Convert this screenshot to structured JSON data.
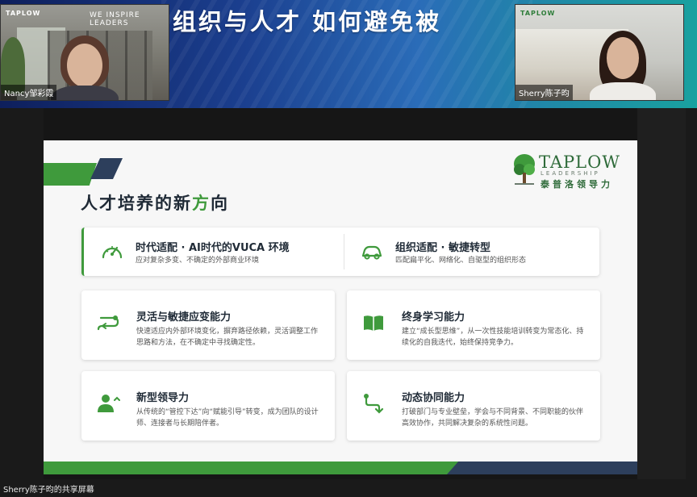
{
  "banner": {
    "title": "组织与人才 如何避免被"
  },
  "participants": [
    {
      "name": "Nancy邹彩霞",
      "logo": "TAPLOW",
      "tagline": "WE INSPIRE LEADERS"
    },
    {
      "name": "Sherry陈子昀",
      "logo": "TAPLOW"
    }
  ],
  "share": {
    "label": "Sherry陈子昀的共享屏幕"
  },
  "slide": {
    "title_pre": "人才培养的新",
    "title_accent": "方",
    "title_post": "向",
    "brand": {
      "name": "TAPLOW",
      "sub": "LEADERSHIP",
      "cn": "泰普洛领导力",
      "color": "#2f6b3a"
    },
    "accent_color": "#3f9a3c",
    "navy_color": "#2d3f5c",
    "top_card": [
      {
        "icon": "speedometer-icon",
        "title": "时代适配 · AI时代的VUCA 环境",
        "desc": "应对复杂多变、不确定的外部商业环境"
      },
      {
        "icon": "car-icon",
        "title": "组织适配 · 敏捷转型",
        "desc": "匹配扁平化、网络化、自驱型的组织形态"
      }
    ],
    "cards": [
      {
        "icon": "switch-arrows-icon",
        "title": "灵活与敏捷应变能力",
        "desc": "快速适应内外部环境变化，摒弃路径依赖，灵活调整工作思路和方法，在不确定中寻找确定性。"
      },
      {
        "icon": "open-book-icon",
        "title": "终身学习能力",
        "desc": "建立“成长型思维”，从一次性技能培训转变为常态化、持续化的自我迭代，始终保持竞争力。"
      },
      {
        "icon": "leader-icon",
        "title": "新型领导力",
        "desc": "从传统的“管控下达”向“赋能引导”转变，成为团队的设计师、连接者与长期陪伴者。"
      },
      {
        "icon": "flow-path-icon",
        "title": "动态协同能力",
        "desc": "打破部门与专业壁垒，学会与不同背景、不同职能的伙伴高效协作，共同解决复杂的系统性问题。"
      }
    ]
  }
}
